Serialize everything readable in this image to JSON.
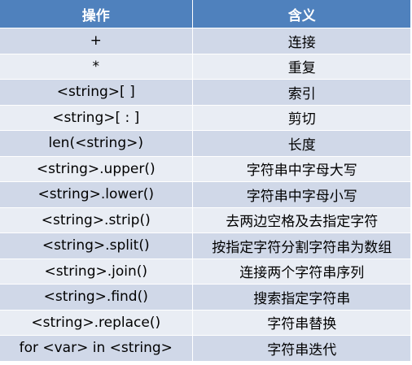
{
  "header": {
    "col1": "操作",
    "col2": "含义"
  },
  "rows": [
    {
      "op": "+",
      "meaning": "连接"
    },
    {
      "op": "*",
      "meaning": "重复"
    },
    {
      "op": "<string>[ ]",
      "meaning": "索引"
    },
    {
      "op": "<string>[ : ]",
      "meaning": "剪切"
    },
    {
      "op": "len(<string>)",
      "meaning": "长度"
    },
    {
      "op": "<string>.upper()",
      "meaning": "字符串中字母大写"
    },
    {
      "op": "<string>.lower()",
      "meaning": "字符串中字母小写"
    },
    {
      "op": "<string>.strip()",
      "meaning": "去两边空格及去指定字符"
    },
    {
      "op": "<string>.split()",
      "meaning": "按指定字符分割字符串为数组"
    },
    {
      "op": "<string>.join()",
      "meaning": "连接两个字符串序列"
    },
    {
      "op": "<string>.find()",
      "meaning": "搜索指定字符串"
    },
    {
      "op": "<string>.replace()",
      "meaning": "字符串替换"
    },
    {
      "op": "for <var> in <string>",
      "meaning": "字符串迭代"
    }
  ],
  "colors": {
    "header_bg": "#4f81bd",
    "row_odd": "#d0d8e8",
    "row_even": "#e9edf4"
  }
}
